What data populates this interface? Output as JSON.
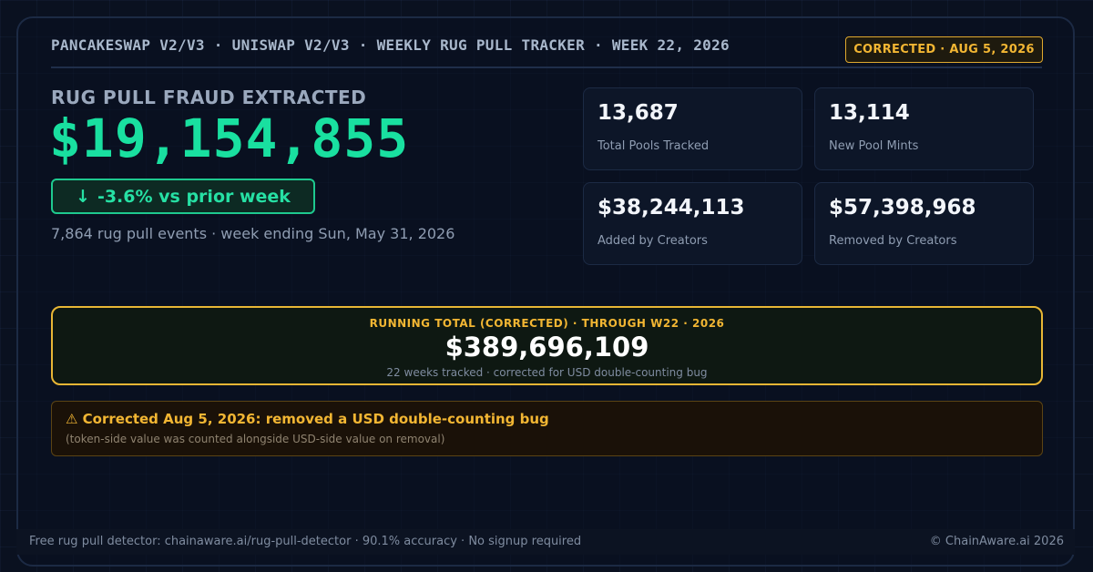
{
  "header": {
    "title": "PANCAKESWAP V2/V3 · UNISWAP V2/V3 · WEEKLY RUG PULL TRACKER · WEEK 22, 2026",
    "badge": "CORRECTED · AUG 5, 2026"
  },
  "main": {
    "label": "RUG PULL FRAUD EXTRACTED",
    "value": "$19,154,855",
    "change_arrow": "↓",
    "change_text": "-3.6% vs prior week",
    "sub_line": "7,864 rug pull events · week ending Sun, May 31, 2026"
  },
  "stats": [
    {
      "value": "13,687",
      "label": "Total Pools Tracked"
    },
    {
      "value": "13,114",
      "label": "New Pool Mints"
    },
    {
      "value": "$38,244,113",
      "label": "Added by Creators"
    },
    {
      "value": "$57,398,968",
      "label": "Removed by Creators"
    }
  ],
  "running_total": {
    "label": "RUNNING TOTAL (CORRECTED) · THROUGH W22 · 2026",
    "value": "$389,696,109",
    "sub": "22 weeks tracked · corrected for USD double-counting bug"
  },
  "notice": {
    "title": "⚠ Corrected Aug 5, 2026: removed a USD double-counting bug",
    "sub": "(token-side value was counted alongside USD-side value on removal)"
  },
  "footer": {
    "left": "Free rug pull detector: chainaware.ai/rug-pull-detector · 90.1% accuracy · No signup required",
    "right": "© ChainAware.ai 2026"
  },
  "colors": {
    "background": "#0a1120",
    "accent_green": "#19e0a0",
    "accent_amber": "#f2b633"
  }
}
